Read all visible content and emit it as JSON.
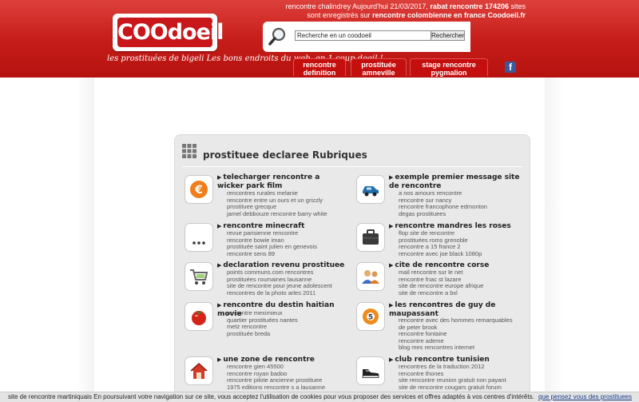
{
  "header": {
    "logo_text": "COOdoeil",
    "tagline": "les prostituées de bigeli Les bons endroits du web, en 1 coup doeil !",
    "info_line1_pre": "rencontre chalindrey Aujourd'hui 21/03/2017, ",
    "info_line1_bold": "rabat rencontre 174206",
    "info_line1_post": " sites",
    "info_line2_pre": "sont enregistrés sur ",
    "info_line2_bold": "rencontre colombienne en france Coodoeil.fr",
    "search_value": "Recherche en un coodoeil",
    "search_button": "Rechercher",
    "nav": [
      {
        "line1": "rencontre",
        "line2": "definition"
      },
      {
        "line1": "prostituée",
        "line2": "amneville"
      },
      {
        "line1": "stage rencontre",
        "line2": "pygmalion"
      }
    ],
    "fb_glyph": "f"
  },
  "panel": {
    "title": "prostituee declaree Rubriques",
    "categories": [
      {
        "icon": "euro-icon",
        "title": "telecharger rencontre a wicker park film",
        "links": [
          "rencontres rurales melanie",
          "rencontre entre un ours et un grizzly",
          "prostituee grecque",
          "jamel debbouze rencontre barry white"
        ]
      },
      {
        "icon": "car-icon",
        "title": "exemple premier message site de rencontre",
        "links": [
          "a nos amours rencontre",
          "rencontre sur nancy",
          "rencontre francophone edmonton",
          "degas prostituees"
        ]
      },
      {
        "icon": "more-icon",
        "title": "rencontre minecraft",
        "links": [
          "revue parisienne rencontre",
          "rencontre bowie iman",
          "prostituée saint julien en genevois",
          "rencontre sens 89"
        ]
      },
      {
        "icon": "briefcase-icon",
        "title": "rencontre mandres les roses",
        "links": [
          "flop site de rencontre",
          "prostituées roms grenoble",
          "rencontre a 15 france 2",
          "rencontre avec joe black 1080p"
        ]
      },
      {
        "icon": "cart-icon",
        "title": "declaration revenu prostituee",
        "links": [
          "points communs.com rencontres",
          "prostituées roumaines lausanne",
          "site de rencontre pour jeune adolescent",
          "rencontres de la photo arles 2011"
        ]
      },
      {
        "icon": "people-icon",
        "title": "cite de rencontre corse",
        "links": [
          "mail rencontre sur le net",
          "rencontre fnac st lazare",
          "site de rencontre europe afrique",
          "site de rencontre a bxl"
        ]
      },
      {
        "icon": "tomato-icon",
        "title": "rencontre du destin haitian movie",
        "links": [
          "rencontre meximieux",
          "quartier prostituées nantes",
          "metz rencontre",
          "prostituée breda"
        ]
      },
      {
        "icon": "lifebuoy-icon",
        "title": "les rencontres de guy de maupassant",
        "links": [
          "rencontre avec des hommes remarquables",
          "de peter brook",
          "rencontre fontaine",
          "rencontre ademe",
          "blog mes rencontres internet"
        ]
      },
      {
        "icon": "house-icon",
        "title": "une zone de rencontre",
        "links": [
          "rencontre gien 45500",
          "rencontre royan badoo",
          "rencontre pilote ancienne prostituee",
          "1975 editions rencontre s a lausanne"
        ]
      },
      {
        "icon": "sneaker-icon",
        "title": "club rencontre tunisien",
        "links": [
          "rencontres de la traduction 2012",
          "rencontre thones",
          "site rencontre reunion gratuit non payant",
          "site de rencontre cougars gratuit forum"
        ]
      }
    ]
  },
  "cookie": {
    "text": "site de rencontre martiniquais En poursuivant votre navigation sur ce site, vous acceptez l'utilisation de cookies pour vous proposer des services et offres adaptés à vos centres d'intérêts.",
    "link": "que pensez vous des prostituees"
  }
}
